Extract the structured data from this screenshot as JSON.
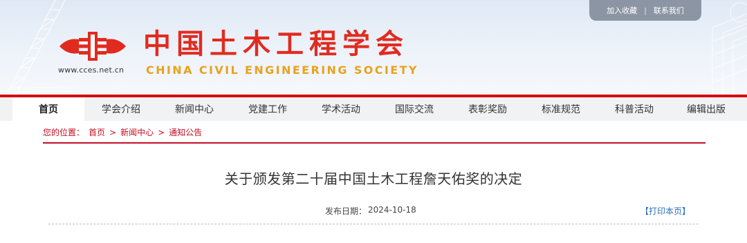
{
  "header": {
    "toplinks": {
      "favorite": "加入收藏",
      "separator": "|",
      "contact": "联系我们"
    },
    "site_url": "www.cces.net.cn",
    "cn_name": "中国土木工程学会",
    "en_name": "CHINA CIVIL ENGINEERING SOCIETY",
    "brand_red": "#e12b1f",
    "brand_gold": "#e8a21b"
  },
  "nav": {
    "items": [
      {
        "label": "首页",
        "active": true
      },
      {
        "label": "学会介绍"
      },
      {
        "label": "新闻中心"
      },
      {
        "label": "党建工作"
      },
      {
        "label": "学术活动"
      },
      {
        "label": "国际交流"
      },
      {
        "label": "表彰奖励"
      },
      {
        "label": "标准规范"
      },
      {
        "label": "科普活动"
      },
      {
        "label": "编辑出版"
      }
    ]
  },
  "breadcrumb": {
    "prefix": "您的位置：",
    "items": [
      "首页",
      "新闻中心",
      "通知公告"
    ],
    "separator": ">"
  },
  "article": {
    "title": "关于颁发第二十届中国土木工程詹天佑奖的决定",
    "date_label": "发布日期：",
    "date": "2024-10-18",
    "print_label": "【打印本页】"
  }
}
